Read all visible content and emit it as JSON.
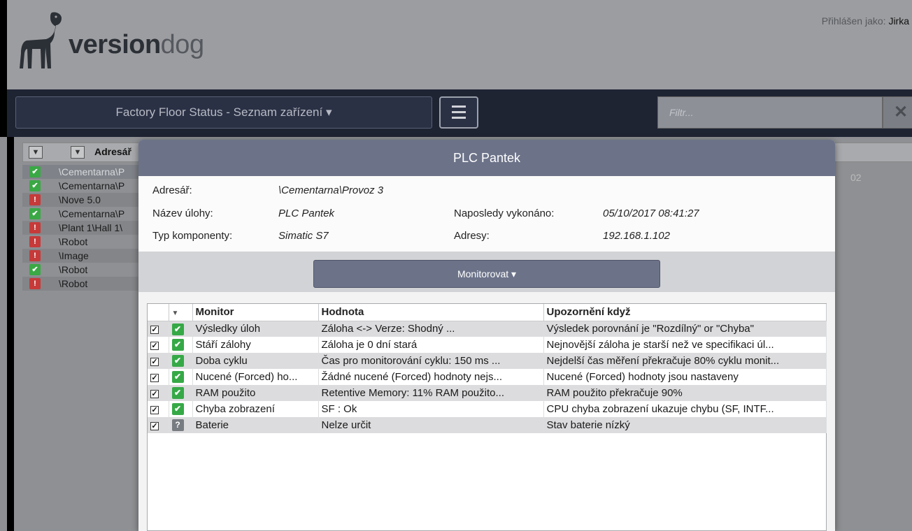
{
  "header": {
    "logo_part1": "version",
    "logo_part2": "dog",
    "login_label": "Přihlášen jako:",
    "login_user": "Jirka"
  },
  "nav": {
    "view_selector": "Factory Floor Status - Seznam zařízení ▾",
    "filter_placeholder": "Filtr...",
    "clear_glyph": "✕"
  },
  "list": {
    "column_label": "Adresář",
    "right_fragment": "02",
    "rows": [
      {
        "status": "ok",
        "path": "\\Cementarna\\P"
      },
      {
        "status": "ok",
        "path": "\\Cementarna\\P"
      },
      {
        "status": "error",
        "path": "\\Nove 5.0"
      },
      {
        "status": "ok",
        "path": "\\Cementarna\\P"
      },
      {
        "status": "error",
        "path": "\\Plant 1\\Hall 1\\"
      },
      {
        "status": "error",
        "path": "\\Robot"
      },
      {
        "status": "error",
        "path": "\\Image"
      },
      {
        "status": "ok",
        "path": "\\Robot"
      },
      {
        "status": "error",
        "path": "\\Robot"
      }
    ]
  },
  "modal": {
    "title": "PLC Pantek",
    "info": {
      "directory_label": "Adresář:",
      "directory_value": "\\Cementarna\\Provoz 3",
      "job_label": "Název úlohy:",
      "job_value": "PLC Pantek",
      "last_run_label": "Naposledy vykonáno:",
      "last_run_value": "05/10/2017 08:41:27",
      "type_label": "Typ komponenty:",
      "type_value": "Simatic S7",
      "address_label": "Adresy:",
      "address_value": "192.168.1.102"
    },
    "monitor_button": "Monitorovat ▾",
    "grid": {
      "headers": {
        "sort": "▼",
        "monitor": "Monitor",
        "value": "Hodnota",
        "alert": "Upozornění když"
      },
      "rows": [
        {
          "checked": true,
          "status": "ok",
          "monitor": "Výsledky úloh",
          "value": "Záloha <-> Verze: Shodný ...",
          "alert": "Výsledek porovnání je \"Rozdílný\" or \"Chyba\""
        },
        {
          "checked": true,
          "status": "ok",
          "monitor": "Stáří zálohy",
          "value": "Záloha je 0 dní stará",
          "alert": "Nejnovější záloha je starší než ve specifikaci úl..."
        },
        {
          "checked": true,
          "status": "ok",
          "monitor": "Doba cyklu",
          "value": "Čas pro monitorování cyklu: 150 ms ...",
          "alert": "Nejdelší čas měření překračuje 80% cyklu monit..."
        },
        {
          "checked": true,
          "status": "ok",
          "monitor": "Nucené (Forced) ho...",
          "value": "Žádné nucené (Forced) hodnoty nejs...",
          "alert": "Nucené (Forced) hodnoty jsou nastaveny"
        },
        {
          "checked": true,
          "status": "ok",
          "monitor": "RAM použito",
          "value": "Retentive Memory: 11% RAM použito...",
          "alert": "RAM použito překračuje 90%"
        },
        {
          "checked": true,
          "status": "ok",
          "monitor": "Chyba zobrazení",
          "value": "SF : Ok",
          "alert": "CPU chyba zobrazení ukazuje chybu (SF, INTF..."
        },
        {
          "checked": true,
          "status": "unknown",
          "monitor": "Baterie",
          "value": "Nelze určit",
          "alert": "Stav baterie nízký"
        }
      ]
    }
  },
  "icons": {
    "ok": "check-icon",
    "error": "exclamation-icon",
    "unknown": "question-icon",
    "checkbox": "checkbox-checked-icon",
    "filter": "funnel-icon",
    "menu": "hamburger-icon"
  },
  "colors": {
    "ok": "#36a947",
    "error": "#c63a3a",
    "unknown": "#777b82",
    "modal_header": "#6c7389",
    "navbar": "#1f2433"
  }
}
